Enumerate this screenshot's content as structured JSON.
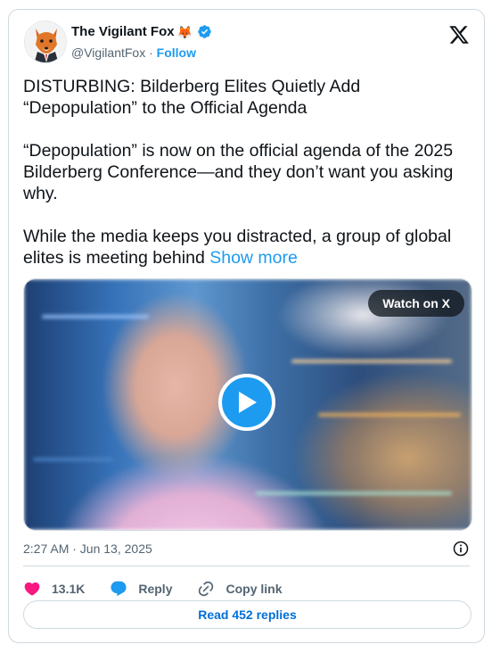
{
  "author": {
    "display_name": "The Vigilant Fox",
    "emoji": "🦊",
    "handle": "@VigilantFox",
    "separator": "·",
    "follow_label": "Follow"
  },
  "tweet": {
    "paragraphs": [
      "DISTURBING: Bilderberg Elites Quietly Add “Depopulation” to the Official Agenda",
      "“Depopulation” is now on the official agenda of the 2025 Bilderberg Conference—and they don’t want you asking why.",
      "While the media keeps you distracted, a group of global elites is meeting behind"
    ],
    "show_more_label": "Show more"
  },
  "media": {
    "watch_label": "Watch on X"
  },
  "timestamp": "2:27 AM · Jun 13, 2025",
  "actions": {
    "like_count": "13.1K",
    "reply_label": "Reply",
    "copy_link_label": "Copy link"
  },
  "read_replies_label": "Read 452 replies",
  "colors": {
    "accent": "#1d9bf0",
    "like": "#f91880",
    "text": "#0f1419",
    "muted": "#536471",
    "border": "#cfd9de"
  }
}
